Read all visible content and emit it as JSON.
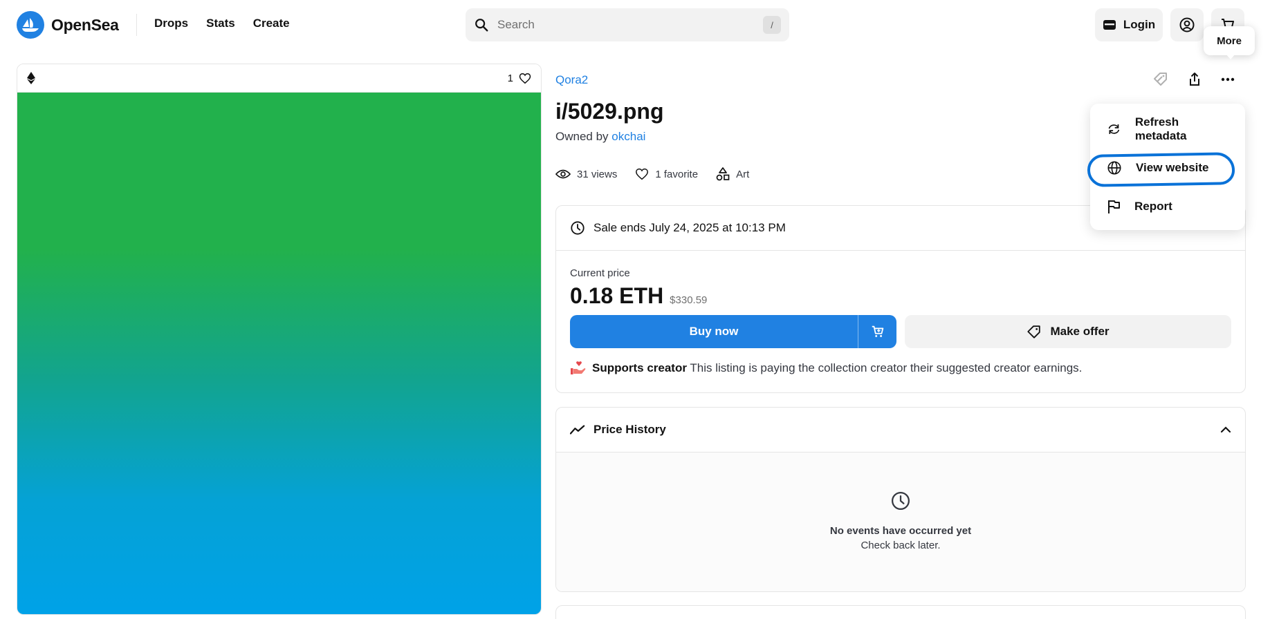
{
  "header": {
    "brand": "OpenSea",
    "nav": [
      "Drops",
      "Stats",
      "Create"
    ],
    "search_placeholder": "Search",
    "search_shortcut": "/",
    "login_label": "Login",
    "tooltip": "More"
  },
  "image_panel": {
    "favorite_count": "1"
  },
  "item": {
    "collection": "Qora2",
    "title": "i/5029.png",
    "owned_by_prefix": "Owned by",
    "owner": "okchai",
    "views": "31 views",
    "favorites": "1 favorite",
    "category": "Art"
  },
  "listing": {
    "sale_ends": "Sale ends July 24, 2025 at 10:13 PM",
    "current_price_label": "Current price",
    "price_eth": "0.18 ETH",
    "price_usd": "$330.59",
    "buy_now_label": "Buy now",
    "make_offer_label": "Make offer",
    "creator_title": "Supports creator",
    "creator_text": "This listing is paying the collection creator their suggested creator earnings."
  },
  "price_history": {
    "title": "Price History",
    "empty_title": "No events have occurred yet",
    "empty_sub": "Check back later."
  },
  "menu": {
    "items": [
      "Refresh metadata",
      "View website",
      "Report"
    ]
  },
  "colors": {
    "accent": "#2081e2",
    "highlight": "#0a72d8",
    "image_top": "#22b14c",
    "image_bottom": "#00a2e8"
  }
}
